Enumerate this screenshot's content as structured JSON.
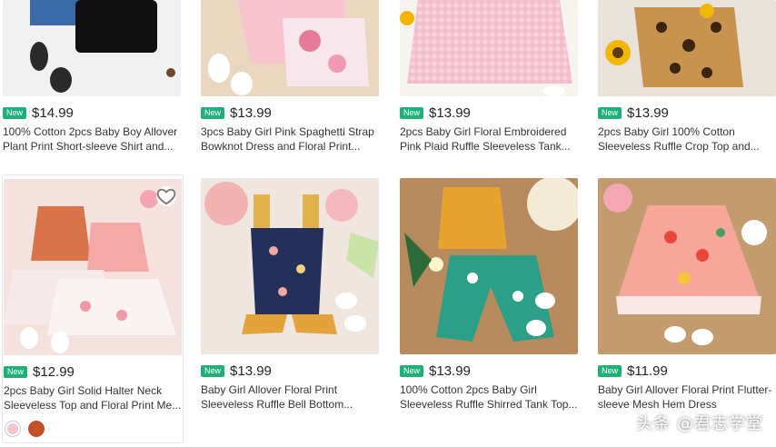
{
  "products": [
    {
      "badge": "New",
      "price": "$14.99",
      "title": "100% Cotton 2pcs Baby Boy Allover\nPlant Print Short-sleeve Shirt and..."
    },
    {
      "badge": "New",
      "price": "$13.99",
      "title": "3pcs Baby Girl Pink Spaghetti Strap\nBowknot Dress and Floral Print..."
    },
    {
      "badge": "New",
      "price": "$13.99",
      "title": "2pcs Baby Girl Floral Embroidered\nPink Plaid Ruffle Sleeveless Tank..."
    },
    {
      "badge": "New",
      "price": "$13.99",
      "title": "2pcs Baby Girl 100% Cotton\nSleeveless Ruffle Crop Top and..."
    },
    {
      "badge": "New",
      "price": "$12.99",
      "title": "2pcs Baby Girl Solid Halter Neck\nSleeveless Top and Floral Print Me..."
    },
    {
      "badge": "New",
      "price": "$13.99",
      "title": "Baby Girl Allover Floral Print\nSleeveless Ruffle Bell Bottom..."
    },
    {
      "badge": "New",
      "price": "$13.99",
      "title": "100% Cotton 2pcs Baby Girl\nSleeveless Ruffle Shirred Tank Top..."
    },
    {
      "badge": "New",
      "price": "$11.99",
      "title": "Baby Girl Allover Floral Print Flutter-\nsleeve Mesh Hem Dress"
    }
  ],
  "swatch_colors": [
    "#f3c6cf",
    "#c4502a"
  ],
  "watermark": "头条 @君志学堂"
}
